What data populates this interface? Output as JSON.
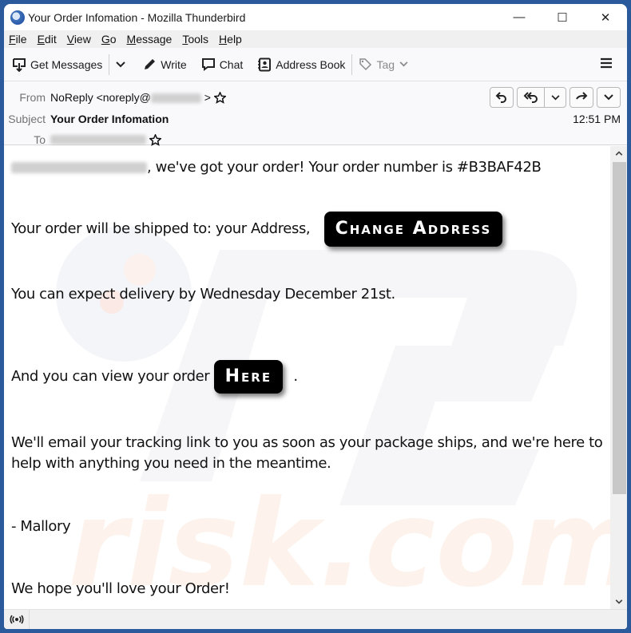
{
  "window": {
    "title": "Your Order Infomation - Mozilla Thunderbird",
    "controls": {
      "minimize": "—",
      "maximize": "☐",
      "close": "✕"
    }
  },
  "menubar": {
    "items": [
      {
        "accel": "F",
        "rest": "ile"
      },
      {
        "accel": "E",
        "rest": "dit"
      },
      {
        "accel": "V",
        "rest": "iew"
      },
      {
        "accel": "G",
        "rest": "o"
      },
      {
        "accel": "M",
        "rest": "essage"
      },
      {
        "accel": "T",
        "rest": "ools"
      },
      {
        "accel": "H",
        "rest": "elp"
      }
    ]
  },
  "toolbar": {
    "get_messages": "Get Messages",
    "write": "Write",
    "chat": "Chat",
    "address_book": "Address Book",
    "tag": "Tag"
  },
  "header": {
    "from_label": "From",
    "from_name": "NoReply <noreply@",
    "from_suffix": ">",
    "subject_label": "Subject",
    "subject": "Your Order Infomation",
    "to_label": "To",
    "time": "12:51 PM"
  },
  "message": {
    "line1_suffix": ", we've got your order! Your order number is #B3BAF42B",
    "line2_prefix": "Your order will be shipped to: your Address,",
    "change_address_button": "Change Address",
    "line3": "You can expect delivery by Wednesday December 21st.",
    "line4_prefix": "And you can view your order",
    "here_button": "Here",
    "line4_suffix": ".",
    "line5a": "We'll email your tracking link to you as soon as your package ships, and we're here to",
    "line5b": "help with anything you need in the meantime.",
    "signature": "- Mallory",
    "closing": "We hope you'll love your Order!"
  },
  "colors": {
    "desktop_frame": "#2a5a9c",
    "cta_background": "#000000",
    "cta_text": "#ffffff"
  }
}
